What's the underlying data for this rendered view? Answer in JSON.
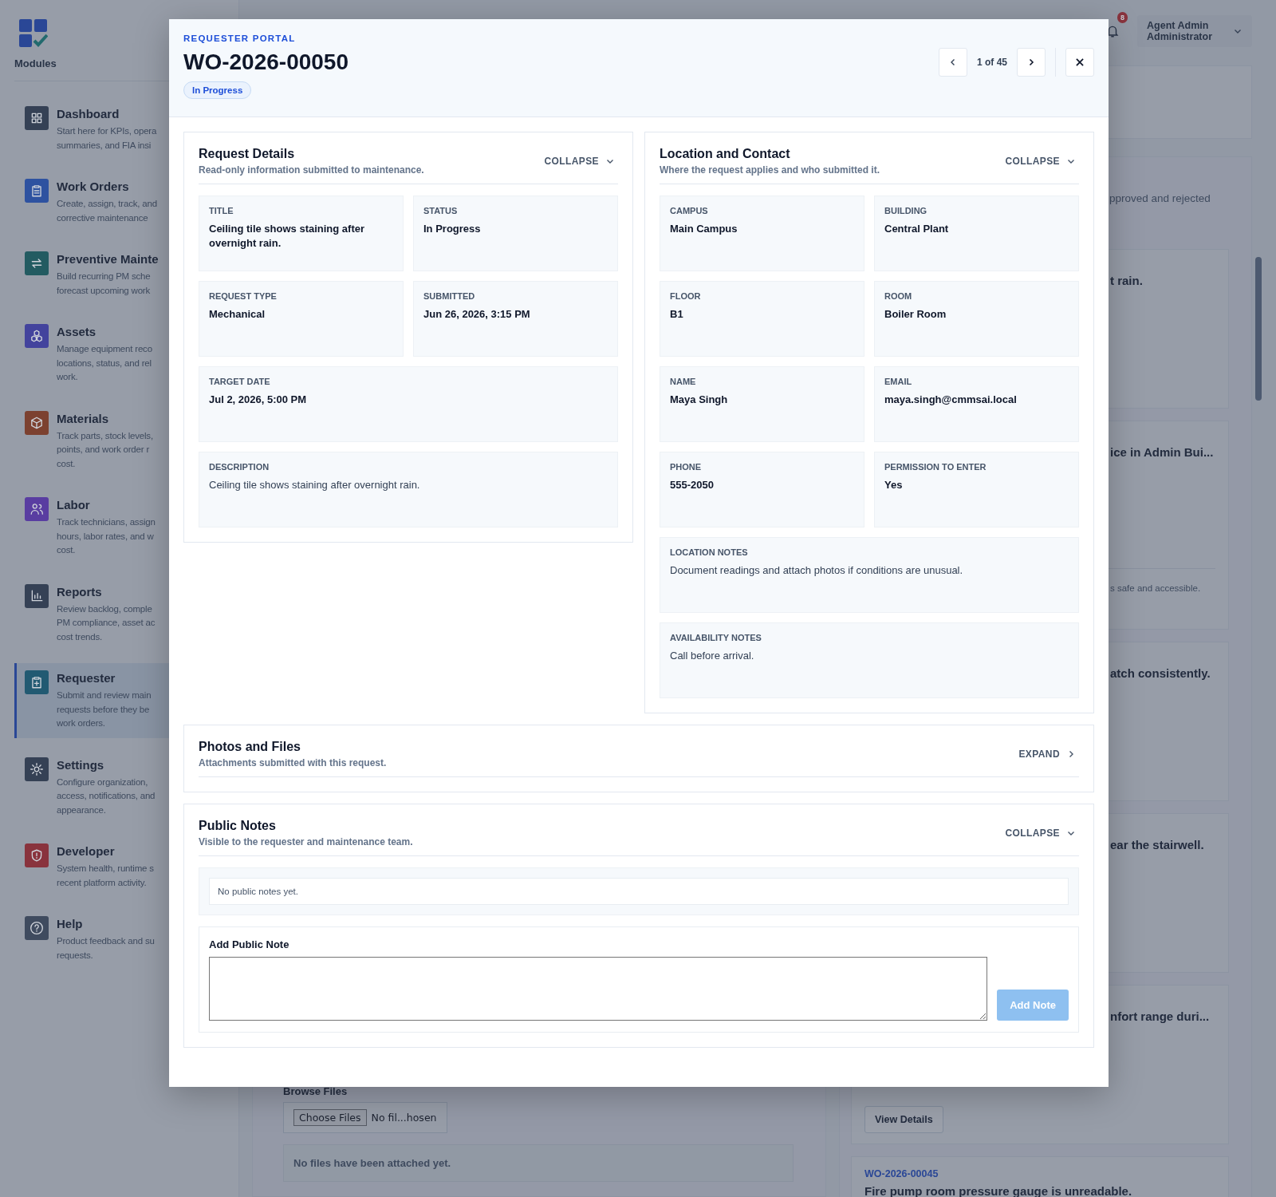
{
  "sidebar": {
    "heading": "Modules",
    "items": [
      {
        "title": "Dashboard",
        "description_lines": [
          "Start here for KPIs, opera",
          "summaries, and FIA insi"
        ],
        "color": "#354155",
        "selected": false
      },
      {
        "title": "Work Orders",
        "description_lines": [
          "Create, assign, track, and",
          "corrective maintenance"
        ],
        "color": "#2e52a0",
        "selected": false
      },
      {
        "title": "Preventive Mainte",
        "description_lines": [
          "Build recurring PM sche",
          "forecast upcoming work"
        ],
        "color": "#235b61",
        "selected": false
      },
      {
        "title": "Assets",
        "description_lines": [
          "Manage equipment reco",
          "locations, status, and rel",
          "work."
        ],
        "color": "#43439d",
        "selected": false
      },
      {
        "title": "Materials",
        "description_lines": [
          "Track parts, stock levels,",
          "points, and work order r",
          "cost."
        ],
        "color": "#7c4130",
        "selected": false
      },
      {
        "title": "Labor",
        "description_lines": [
          "Track technicians, assign",
          "hours, labor rates, and w",
          "cost."
        ],
        "color": "#593da1",
        "selected": false
      },
      {
        "title": "Reports",
        "description_lines": [
          "Review backlog, comple",
          "PM compliance, asset ac",
          "cost trends."
        ],
        "color": "#354155",
        "selected": false
      },
      {
        "title": "Requester",
        "description_lines": [
          "Submit and review main",
          "requests before they be",
          "work orders."
        ],
        "color": "#225a72",
        "selected": true
      },
      {
        "title": "Settings",
        "description_lines": [
          "Configure organization,",
          "access, notifications, and",
          "appearance."
        ],
        "color": "#354155",
        "selected": false
      },
      {
        "title": "Developer",
        "description_lines": [
          "System health, runtime s",
          "recent platform activity."
        ],
        "color": "#89333d",
        "selected": false
      },
      {
        "title": "Help",
        "description_lines": [
          "Product feedback and su",
          "requests."
        ],
        "color": "#3f4b5f",
        "selected": false
      }
    ]
  },
  "topbar": {
    "notification_count": "8",
    "user_name": "Agent Admin",
    "user_role": "Administrator"
  },
  "attachments_form": {
    "label": "Browse Files",
    "choose_button": "Choose Files",
    "file_status": "No fil...hosen",
    "empty_message": "No files have been attached yet."
  },
  "requests_panel": {
    "subtitle": "pproved and rejected",
    "cards": [
      {
        "kind": "covered",
        "title": "t rain."
      },
      {
        "kind": "covered",
        "title": "ice in Admin Bui...",
        "note": "s safe and accessible."
      },
      {
        "kind": "covered",
        "title": "atch consistently."
      },
      {
        "kind": "covered",
        "title": "ear the stairwell."
      },
      {
        "kind": "covered",
        "title": "nfort range duri...",
        "button": "View Details"
      },
      {
        "kind": "open",
        "link": "WO-2026-00045",
        "title": "Fire pump room pressure gauge is unreadable."
      }
    ]
  },
  "modal": {
    "eyebrow": "REQUESTER PORTAL",
    "title": "WO-2026-00050",
    "status_badge": "In Progress",
    "pager": "1 of 45",
    "detail_sections": [
      {
        "title": "Request Details",
        "subtitle": "Read-only information submitted to maintenance.",
        "toggle": "COLLAPSE",
        "expanded": true,
        "fields": [
          {
            "kind": "short",
            "label": "TITLE",
            "value": "Ceiling tile shows staining after overnight rain."
          },
          {
            "kind": "short",
            "label": "STATUS",
            "value": "In Progress"
          },
          {
            "kind": "short",
            "label": "REQUEST TYPE",
            "value": "Mechanical"
          },
          {
            "kind": "short",
            "label": "SUBMITTED",
            "value": "Jun 26, 2026, 3:15 PM"
          },
          {
            "kind": "long",
            "label": "TARGET DATE",
            "value": "Jul 2, 2026, 5:00 PM"
          },
          {
            "kind": "text",
            "label": "DESCRIPTION",
            "value": "Ceiling tile shows staining after overnight rain."
          }
        ]
      },
      {
        "title": "Location and Contact",
        "subtitle": "Where the request applies and who submitted it.",
        "toggle": "COLLAPSE",
        "expanded": true,
        "fields": [
          {
            "kind": "short",
            "label": "CAMPUS",
            "value": "Main Campus"
          },
          {
            "kind": "short",
            "label": "BUILDING",
            "value": "Central Plant"
          },
          {
            "kind": "short",
            "label": "FLOOR",
            "value": "B1"
          },
          {
            "kind": "short",
            "label": "ROOM",
            "value": "Boiler Room"
          },
          {
            "kind": "short",
            "label": "NAME",
            "value": "Maya Singh"
          },
          {
            "kind": "short",
            "label": "EMAIL",
            "value": "maya.singh@cmmsai.local"
          },
          {
            "kind": "short",
            "label": "PHONE",
            "value": "555-2050"
          },
          {
            "kind": "short",
            "label": "PERMISSION TO ENTER",
            "value": "Yes"
          },
          {
            "kind": "text",
            "label": "LOCATION NOTES",
            "value": "Document readings and attach photos if conditions are unusual."
          },
          {
            "kind": "text",
            "label": "AVAILABILITY NOTES",
            "value": "Call before arrival."
          }
        ]
      }
    ],
    "sections": [
      {
        "title": "Photos and Files",
        "subtitle": "Attachments submitted with this request.",
        "toggle": "EXPAND",
        "expanded": false
      },
      {
        "title": "Public Notes",
        "subtitle": "Visible to the requester and maintenance team.",
        "toggle": "COLLAPSE",
        "expanded": true,
        "empty_message": "No public notes yet.",
        "add_label": "Add Public Note",
        "add_button": "Add Note",
        "add_button_disabled": true
      }
    ]
  }
}
